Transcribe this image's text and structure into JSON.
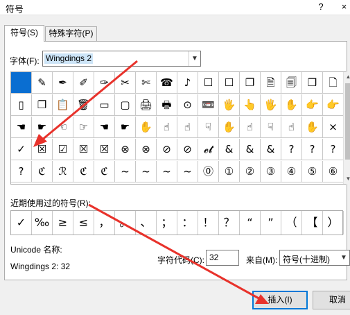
{
  "dialog": {
    "title": "符号",
    "help": "?",
    "close": "×"
  },
  "tabs": [
    {
      "label": "符号(S)"
    },
    {
      "label": "特殊字符(P)"
    }
  ],
  "font": {
    "label": "字体(F):",
    "value": "Wingdings 2"
  },
  "symbol_grid": [
    [
      "",
      "✎",
      "✒",
      "✐",
      "✑",
      "✂",
      "✄",
      "☎",
      "♪",
      "☐",
      "☐",
      "❐",
      "🗎",
      "🗐",
      "❒",
      "🗋"
    ],
    [
      "▯",
      "❐",
      "📋",
      "🗑",
      "▭",
      "▢",
      "🖨",
      "🖶",
      "⊙",
      "📼",
      "🖐",
      "👆",
      "🖐",
      "✋",
      "👉",
      "👉"
    ],
    [
      "☚",
      "☛",
      "☜",
      "☞",
      "☚",
      "☛",
      "✋",
      "☝",
      "☝",
      "☟",
      "✋",
      "☝",
      "☟",
      "☝",
      "✋",
      "×"
    ],
    [
      "✓",
      "☒",
      "☑",
      "☒",
      "☒",
      "⊗",
      "⊗",
      "⊘",
      "⊘",
      "𝓮𝓽",
      "&",
      "&",
      "&",
      "?",
      "?",
      "?"
    ],
    [
      "?",
      "ℭ",
      "ℛ",
      "ℭ",
      "ℭ",
      "~",
      "~",
      "~",
      "~",
      "⓪",
      "①",
      "②",
      "③",
      "④",
      "⑤",
      "⑥"
    ]
  ],
  "recent": {
    "label": "近期使用过的符号(R):",
    "symbols": [
      "✓",
      "‰",
      "≥",
      "≤",
      "，",
      "。",
      "、",
      "；",
      "：",
      "！",
      "？",
      "“",
      "”",
      "（",
      "【",
      "）"
    ]
  },
  "unicode": {
    "label": "Unicode 名称:",
    "value": "Wingdings 2: 32"
  },
  "char_code": {
    "label": "字符代码(C):",
    "value": "32"
  },
  "from": {
    "label": "来自(M):",
    "value": "符号(十进制)"
  },
  "buttons": {
    "insert": "插入(I)",
    "cancel": "取消"
  },
  "colors": {
    "selection": "#0a6ed1",
    "annotation_arrow": "#e8322b"
  }
}
